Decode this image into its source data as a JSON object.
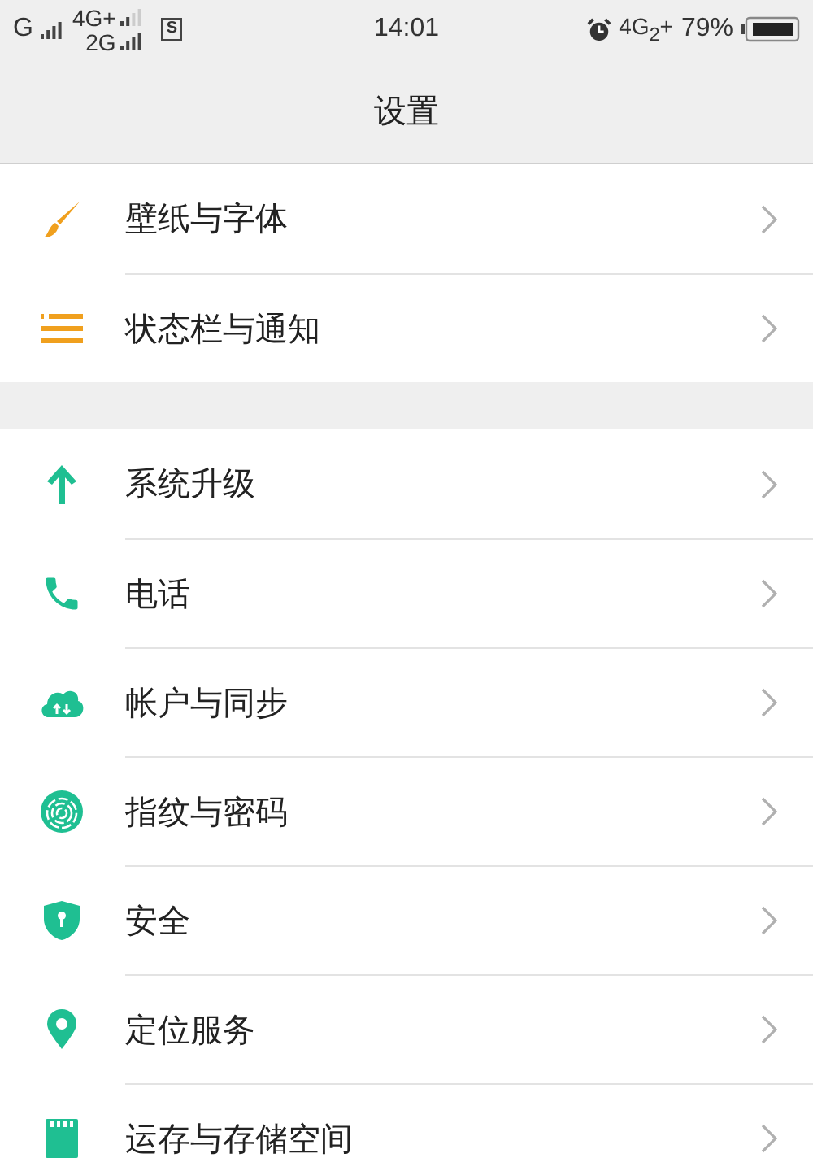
{
  "status_bar": {
    "carrier_1": "G",
    "network_1": "4G+",
    "network_2": "2G",
    "sim_badge": "S",
    "time": "14:01",
    "network_3": "4G$_{2}$+",
    "battery": "79%"
  },
  "header": {
    "title": "设置"
  },
  "sections": [
    {
      "items": [
        {
          "label": "壁纸与字体"
        },
        {
          "label": "状态栏与通知"
        }
      ]
    },
    {
      "items": [
        {
          "label": "系统升级"
        },
        {
          "label": "电话"
        },
        {
          "label": "帐户与同步"
        },
        {
          "label": "指纹与密码"
        },
        {
          "label": "安全"
        },
        {
          "label": "定位服务"
        },
        {
          "label": "运存与存储空间"
        }
      ]
    }
  ]
}
